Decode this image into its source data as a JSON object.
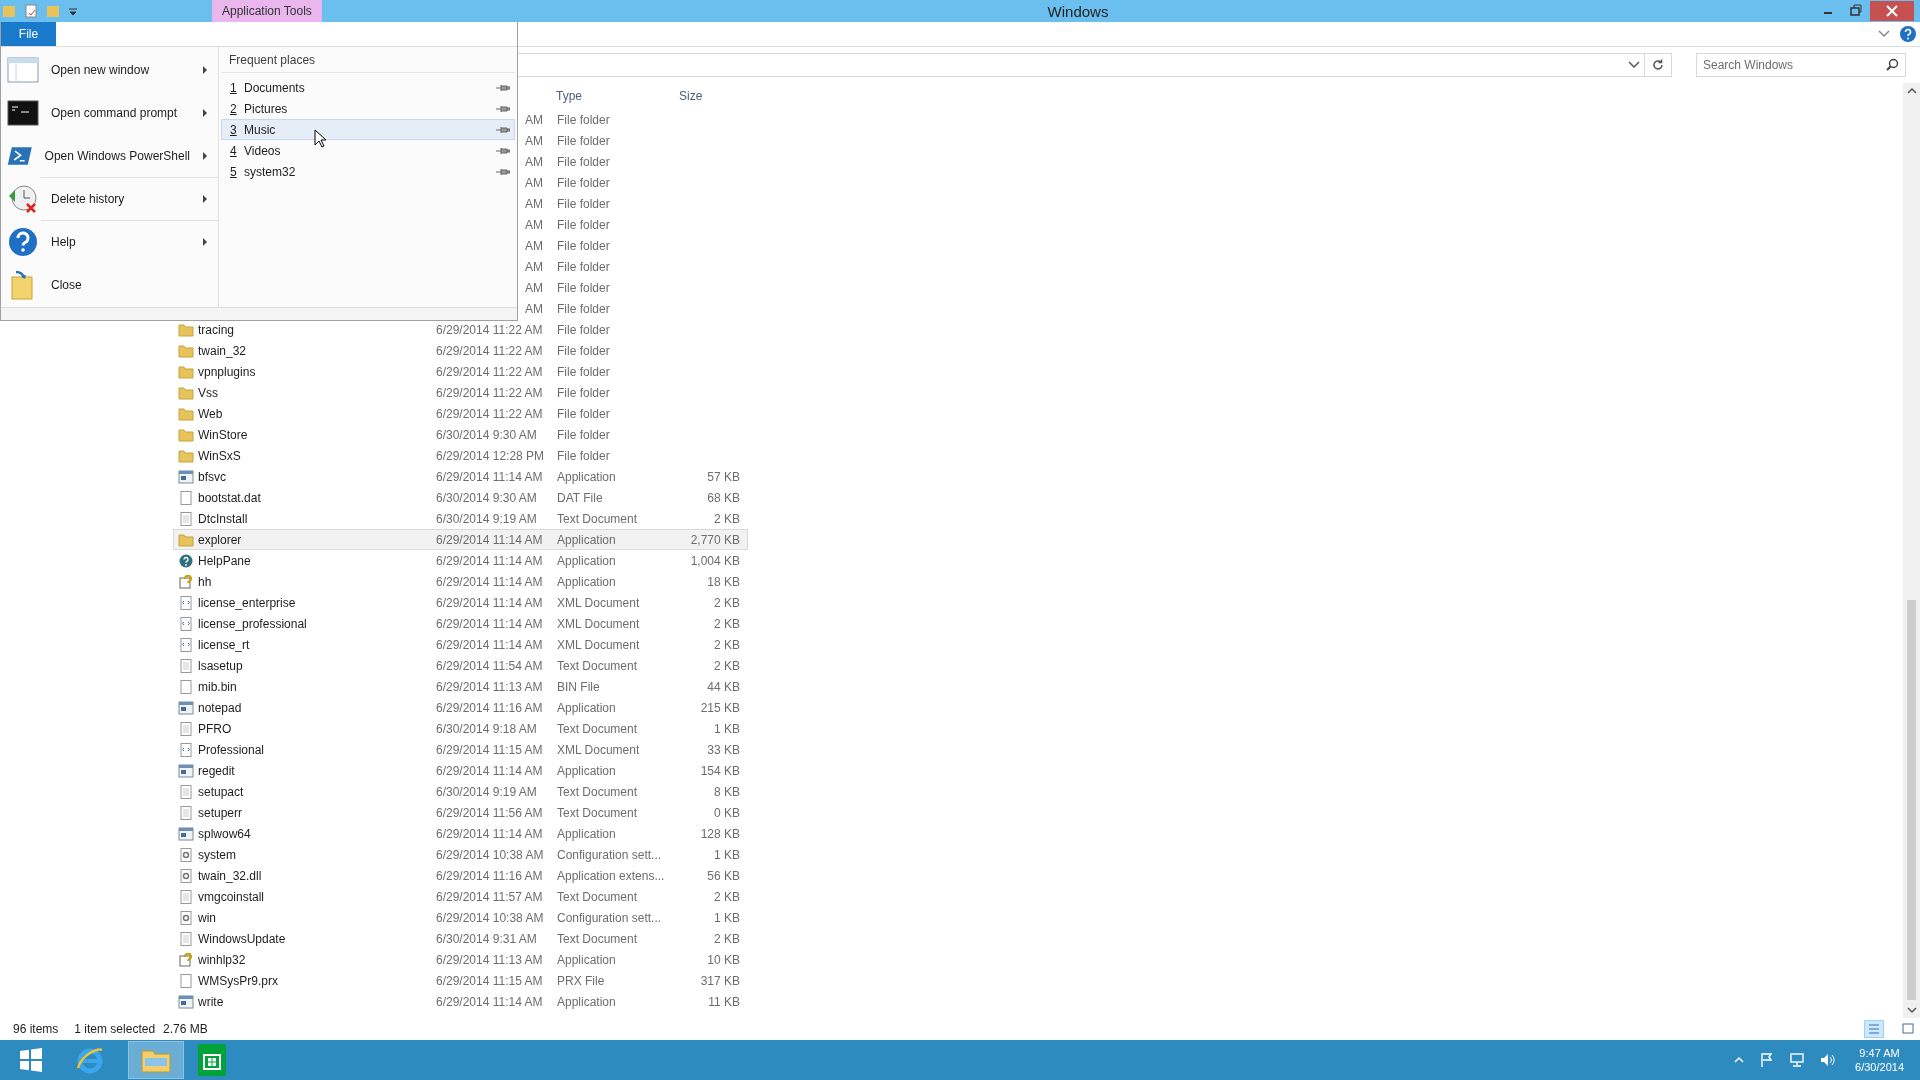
{
  "title_bar": {
    "context_tab": "Application Tools",
    "title": "Windows"
  },
  "file_menu": {
    "tab": "File",
    "commands": [
      {
        "label": "Open new window",
        "kind": "window",
        "submenu": true,
        "divider_before": false
      },
      {
        "label": "Open command prompt",
        "kind": "console",
        "submenu": true,
        "divider_before": false
      },
      {
        "label": "Open Windows PowerShell",
        "kind": "shell",
        "submenu": true,
        "divider_before": false
      },
      {
        "label": "Delete history",
        "kind": "history",
        "submenu": true,
        "divider_before": true
      },
      {
        "label": "Help",
        "kind": "help",
        "submenu": true,
        "divider_before": true
      },
      {
        "label": "Close",
        "kind": "close",
        "submenu": false,
        "divider_before": false
      }
    ],
    "frequent_places": {
      "heading": "Frequent places",
      "items": [
        {
          "number": "1",
          "label": "Documents",
          "selected": false
        },
        {
          "number": "2",
          "label": "Pictures",
          "selected": false
        },
        {
          "number": "3",
          "label": "Music",
          "selected": true
        },
        {
          "number": "4",
          "label": "Videos",
          "selected": false
        },
        {
          "number": "5",
          "label": "system32",
          "selected": false
        }
      ]
    }
  },
  "search": {
    "placeholder": "Search Windows"
  },
  "file_list": {
    "columns": [
      "Type",
      "Size"
    ],
    "rows": [
      {
        "modified": "AM",
        "type": "File folder",
        "selected": false
      },
      {
        "modified": "AM",
        "type": "File folder",
        "selected": false
      },
      {
        "modified": "AM",
        "type": "File folder",
        "selected": false
      },
      {
        "modified": "AM",
        "type": "File folder",
        "selected": false
      },
      {
        "modified": "AM",
        "type": "File folder",
        "selected": false
      },
      {
        "modified": "AM",
        "type": "File folder",
        "selected": false
      },
      {
        "modified": "AM",
        "type": "File folder",
        "selected": false
      },
      {
        "modified": "AM",
        "type": "File folder",
        "selected": false
      },
      {
        "modified": "AM",
        "type": "File folder",
        "selected": false
      },
      {
        "modified": "AM",
        "type": "File folder",
        "selected": false
      },
      {
        "name": "tracing",
        "modified": "6/29/2014 11:22 AM",
        "type": "File folder",
        "kind": "folder",
        "selected": false
      },
      {
        "name": "twain_32",
        "modified": "6/29/2014 11:22 AM",
        "type": "File folder",
        "kind": "folder",
        "selected": false
      },
      {
        "name": "vpnplugins",
        "modified": "6/29/2014 11:22 AM",
        "type": "File folder",
        "kind": "folder",
        "selected": false
      },
      {
        "name": "Vss",
        "modified": "6/29/2014 11:22 AM",
        "type": "File folder",
        "kind": "folder",
        "selected": false
      },
      {
        "name": "Web",
        "modified": "6/29/2014 11:22 AM",
        "type": "File folder",
        "kind": "folder",
        "selected": false
      },
      {
        "name": "WinStore",
        "modified": "6/30/2014 9:30 AM",
        "type": "File folder",
        "kind": "folder",
        "selected": false
      },
      {
        "name": "WinSxS",
        "modified": "6/29/2014 12:28 PM",
        "type": "File folder",
        "kind": "folder",
        "selected": false
      },
      {
        "name": "bfsvc",
        "modified": "6/29/2014 11:14 AM",
        "type": "Application",
        "size": "57 KB",
        "kind": "app",
        "selected": false
      },
      {
        "name": "bootstat.dat",
        "modified": "6/30/2014 9:30 AM",
        "type": "DAT File",
        "size": "68 KB",
        "kind": "blank",
        "selected": false
      },
      {
        "name": "DtcInstall",
        "modified": "6/30/2014 9:19 AM",
        "type": "Text Document",
        "size": "2 KB",
        "kind": "text",
        "selected": false
      },
      {
        "name": "explorer",
        "modified": "6/29/2014 11:14 AM",
        "type": "Application",
        "size": "2,770 KB",
        "kind": "folder",
        "selected": true
      },
      {
        "name": "HelpPane",
        "modified": "6/29/2014 11:14 AM",
        "type": "Application",
        "size": "1,004 KB",
        "kind": "help",
        "selected": false
      },
      {
        "name": "hh",
        "modified": "6/29/2014 11:14 AM",
        "type": "Application",
        "size": "18 KB",
        "kind": "helpdoc",
        "selected": false
      },
      {
        "name": "license_enterprise",
        "modified": "6/29/2014 11:14 AM",
        "type": "XML Document",
        "size": "2 KB",
        "kind": "xml",
        "selected": false
      },
      {
        "name": "license_professional",
        "modified": "6/29/2014 11:14 AM",
        "type": "XML Document",
        "size": "2 KB",
        "kind": "xml",
        "selected": false
      },
      {
        "name": "license_rt",
        "modified": "6/29/2014 11:14 AM",
        "type": "XML Document",
        "size": "2 KB",
        "kind": "xml",
        "selected": false
      },
      {
        "name": "lsasetup",
        "modified": "6/29/2014 11:54 AM",
        "type": "Text Document",
        "size": "2 KB",
        "kind": "text",
        "selected": false
      },
      {
        "name": "mib.bin",
        "modified": "6/29/2014 11:13 AM",
        "type": "BIN File",
        "size": "44 KB",
        "kind": "blank",
        "selected": false
      },
      {
        "name": "notepad",
        "modified": "6/29/2014 11:16 AM",
        "type": "Application",
        "size": "215 KB",
        "kind": "app",
        "selected": false
      },
      {
        "name": "PFRO",
        "modified": "6/30/2014 9:18 AM",
        "type": "Text Document",
        "size": "1 KB",
        "kind": "text",
        "selected": false
      },
      {
        "name": "Professional",
        "modified": "6/29/2014 11:15 AM",
        "type": "XML Document",
        "size": "33 KB",
        "kind": "xml",
        "selected": false
      },
      {
        "name": "regedit",
        "modified": "6/29/2014 11:14 AM",
        "type": "Application",
        "size": "154 KB",
        "kind": "app",
        "selected": false
      },
      {
        "name": "setupact",
        "modified": "6/30/2014 9:19 AM",
        "type": "Text Document",
        "size": "8 KB",
        "kind": "text",
        "selected": false
      },
      {
        "name": "setuperr",
        "modified": "6/29/2014 11:56 AM",
        "type": "Text Document",
        "size": "0 KB",
        "kind": "text",
        "selected": false
      },
      {
        "name": "splwow64",
        "modified": "6/29/2014 11:14 AM",
        "type": "Application",
        "size": "128 KB",
        "kind": "app",
        "selected": false
      },
      {
        "name": "system",
        "modified": "6/29/2014 10:38 AM",
        "type": "Configuration sett...",
        "size": "1 KB",
        "kind": "config",
        "selected": false
      },
      {
        "name": "twain_32.dll",
        "modified": "6/29/2014 11:16 AM",
        "type": "Application extens...",
        "size": "56 KB",
        "kind": "config",
        "selected": false
      },
      {
        "name": "vmgcoinstall",
        "modified": "6/29/2014 11:57 AM",
        "type": "Text Document",
        "size": "2 KB",
        "kind": "text",
        "selected": false
      },
      {
        "name": "win",
        "modified": "6/29/2014 10:38 AM",
        "type": "Configuration sett...",
        "size": "1 KB",
        "kind": "config",
        "selected": false
      },
      {
        "name": "WindowsUpdate",
        "modified": "6/30/2014 9:31 AM",
        "type": "Text Document",
        "size": "2 KB",
        "kind": "text",
        "selected": false
      },
      {
        "name": "winhlp32",
        "modified": "6/29/2014 11:13 AM",
        "type": "Application",
        "size": "10 KB",
        "kind": "helpdoc",
        "selected": false
      },
      {
        "name": "WMSysPr9.prx",
        "modified": "6/29/2014 11:15 AM",
        "type": "PRX File",
        "size": "317 KB",
        "kind": "blank",
        "selected": false
      },
      {
        "name": "write",
        "modified": "6/29/2014 11:14 AM",
        "type": "Application",
        "size": "11 KB",
        "kind": "app",
        "selected": false
      }
    ]
  },
  "status_bar": {
    "count": "96 items",
    "selection": "1 item selected",
    "selection_size": "2.76 MB"
  },
  "taskbar": {
    "time": "9:47 AM",
    "date": "6/30/2014"
  }
}
